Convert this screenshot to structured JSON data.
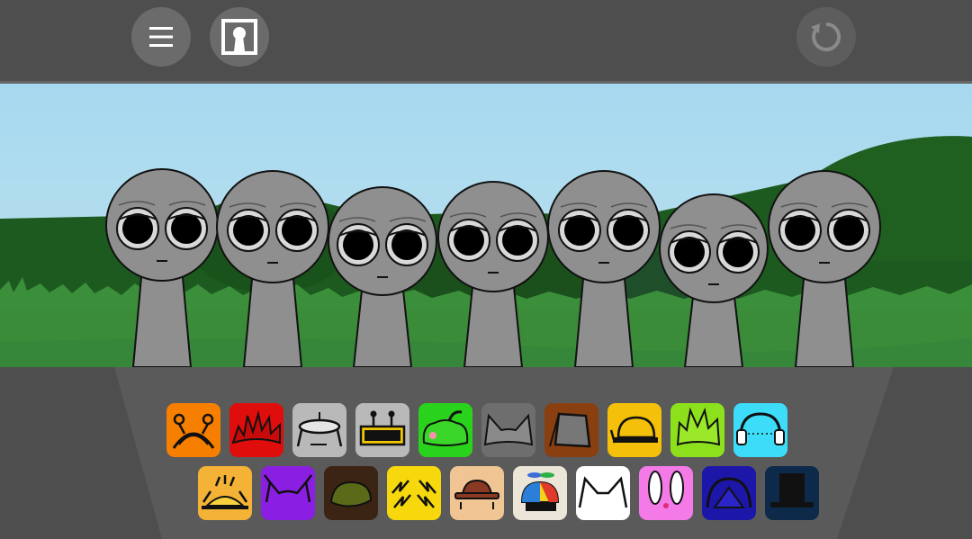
{
  "toolbar": {
    "menu_icon": "hamburger-menu-icon",
    "gallery_icon": "keyhole-frame-icon",
    "reset_icon": "rotate-arrow-icon"
  },
  "stage": {
    "characters": [
      {
        "slot": 1,
        "state": "idle"
      },
      {
        "slot": 2,
        "state": "idle"
      },
      {
        "slot": 3,
        "state": "idle"
      },
      {
        "slot": 4,
        "state": "idle"
      },
      {
        "slot": 5,
        "state": "idle"
      },
      {
        "slot": 6,
        "state": "idle"
      },
      {
        "slot": 7,
        "state": "idle"
      }
    ]
  },
  "sound_icons": {
    "row1": [
      {
        "name": "orange-curly-antenna",
        "color": "#f77f00"
      },
      {
        "name": "red-spiky-hair",
        "color": "#e00d0d"
      },
      {
        "name": "silver-halo-disc",
        "color": "#b9b9b9"
      },
      {
        "name": "silver-robot-antenna",
        "color": "#b9b9b9"
      },
      {
        "name": "green-pepper-hat",
        "color": "#2ad31b"
      },
      {
        "name": "gray-cat-ears",
        "color": "#6e6e6e"
      },
      {
        "name": "brown-bucket-hat",
        "color": "#8a3f10"
      },
      {
        "name": "yellow-hard-hat",
        "color": "#f5c00a"
      },
      {
        "name": "lime-spiky-hair",
        "color": "#8de01c"
      },
      {
        "name": "cyan-headphones",
        "color": "#3ddcf8"
      }
    ],
    "row2": [
      {
        "name": "yellow-sun-crown",
        "color": "#f4b236"
      },
      {
        "name": "purple-horns",
        "color": "#8a1fe3"
      },
      {
        "name": "olive-leaf-hat",
        "color": "#3c2414"
      },
      {
        "name": "yellow-lightning-hair",
        "color": "#f6d80c"
      },
      {
        "name": "peach-fedora",
        "color": "#f0c493"
      },
      {
        "name": "propeller-beanie",
        "color": "#ece6d8"
      },
      {
        "name": "white-cat-ears",
        "color": "#ffffff"
      },
      {
        "name": "pink-bunny-ears",
        "color": "#f47ae8"
      },
      {
        "name": "navy-hood",
        "color": "#1c17a8"
      },
      {
        "name": "black-top-hat",
        "color": "#0d2a4a"
      }
    ]
  }
}
